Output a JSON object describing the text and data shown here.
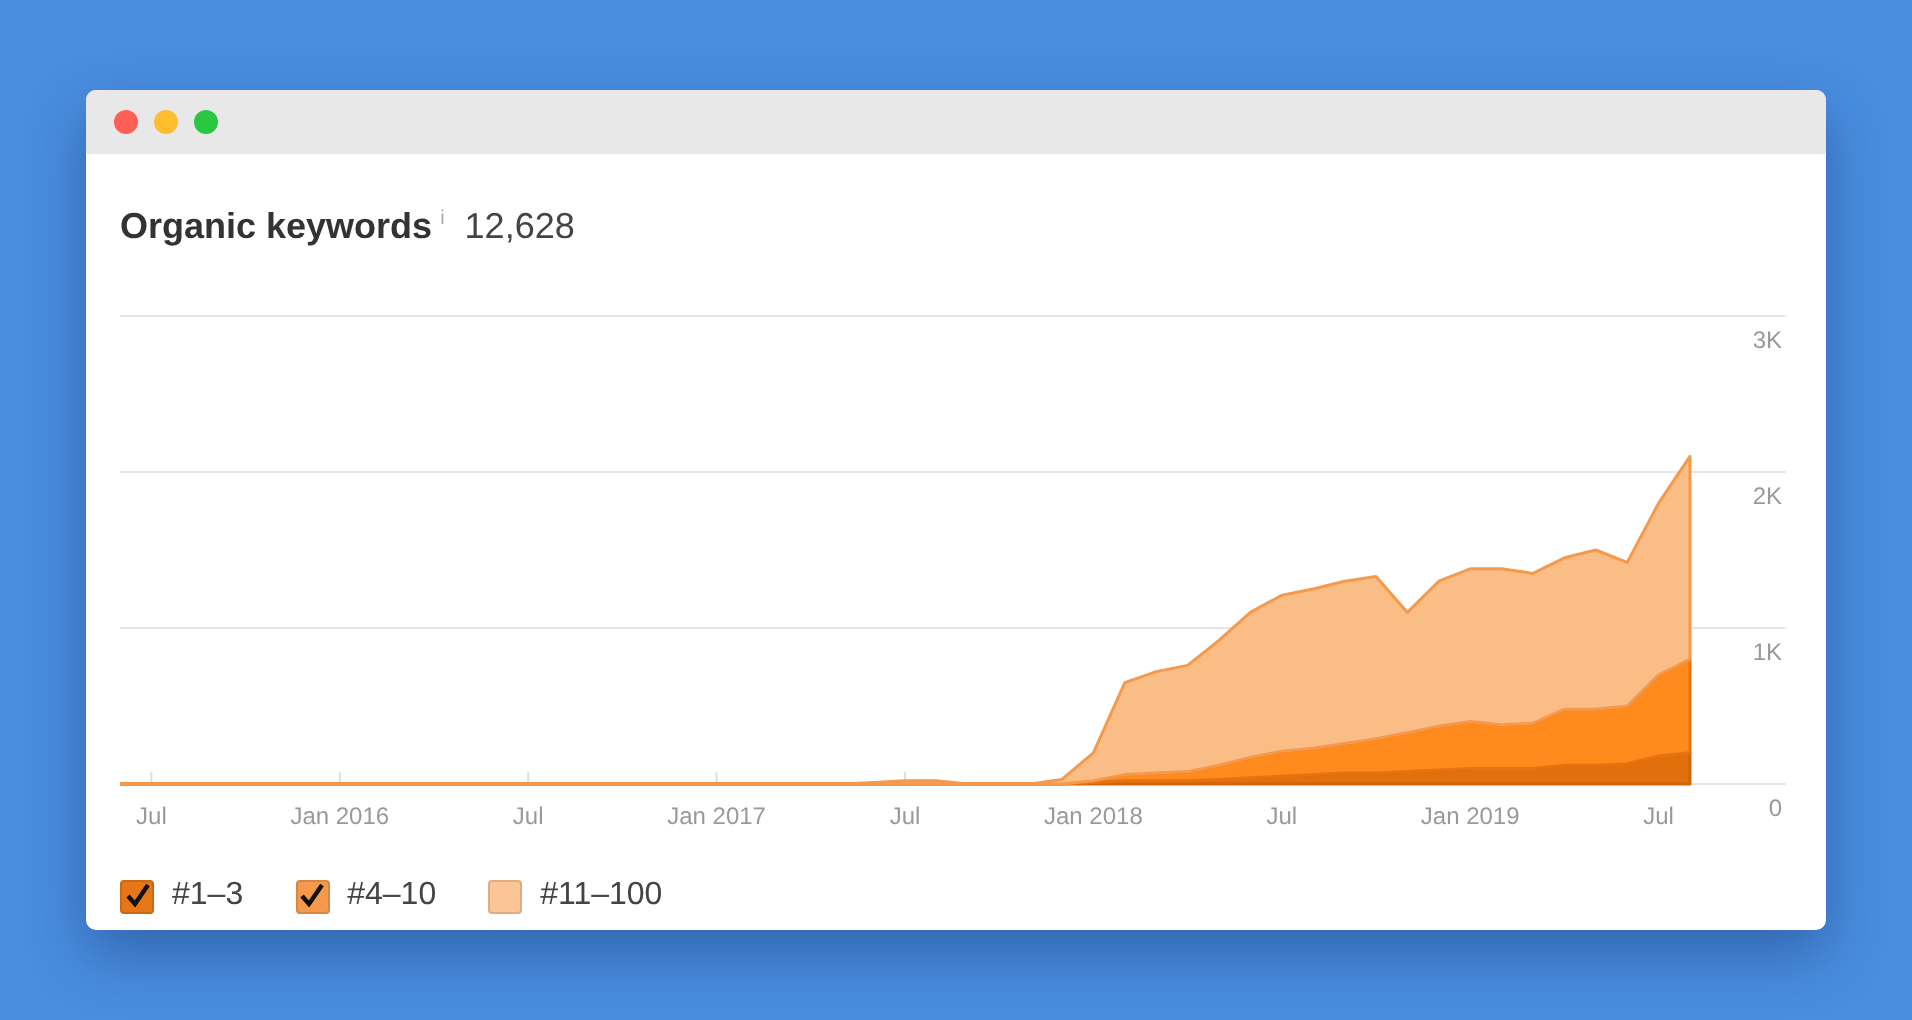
{
  "window": {
    "controls": [
      {
        "color": "#fe5f57"
      },
      {
        "color": "#febc2e"
      },
      {
        "color": "#28c840"
      }
    ]
  },
  "header": {
    "title": "Organic keywords",
    "info": "i",
    "value": "12,628"
  },
  "chart_data": {
    "type": "area",
    "stacked": true,
    "categories": [
      null,
      "Jul",
      null,
      null,
      null,
      null,
      null,
      "Jan 2016",
      null,
      null,
      null,
      null,
      null,
      "Jul",
      null,
      null,
      null,
      null,
      null,
      "Jan 2017",
      null,
      null,
      null,
      null,
      null,
      "Jul",
      null,
      null,
      null,
      null,
      null,
      "Jan 2018",
      null,
      null,
      null,
      null,
      null,
      "Jul",
      null,
      null,
      null,
      null,
      null,
      "Jan 2019",
      null,
      null,
      null,
      null,
      null,
      "Jul",
      null
    ],
    "series": [
      {
        "name": "#1–3",
        "color": "#e06f0c",
        "values": [
          0,
          0,
          0,
          0,
          0,
          0,
          0,
          0,
          0,
          0,
          0,
          0,
          0,
          0,
          0,
          0,
          0,
          0,
          0,
          0,
          0,
          0,
          0,
          0,
          0,
          0,
          0,
          0,
          0,
          0,
          0,
          10,
          20,
          20,
          20,
          30,
          40,
          50,
          60,
          70,
          70,
          80,
          90,
          100,
          100,
          100,
          120,
          120,
          130,
          180,
          200
        ]
      },
      {
        "name": "#4–10",
        "color": "#ff8a1e",
        "values": [
          0,
          0,
          0,
          0,
          0,
          0,
          0,
          0,
          0,
          0,
          0,
          0,
          0,
          0,
          0,
          0,
          0,
          0,
          0,
          0,
          0,
          0,
          0,
          0,
          0,
          0,
          0,
          0,
          0,
          0,
          0,
          10,
          40,
          50,
          60,
          90,
          130,
          160,
          170,
          190,
          220,
          250,
          280,
          300,
          280,
          290,
          360,
          360,
          370,
          520,
          600
        ]
      },
      {
        "name": "#11–100",
        "color": "#fbbd86",
        "values": [
          0,
          0,
          0,
          0,
          0,
          0,
          0,
          0,
          0,
          0,
          0,
          0,
          0,
          0,
          0,
          0,
          0,
          0,
          0,
          0,
          0,
          0,
          0,
          0,
          10,
          20,
          20,
          0,
          0,
          0,
          30,
          180,
          590,
          650,
          680,
          800,
          930,
          1000,
          1020,
          1040,
          1040,
          770,
          930,
          980,
          1000,
          960,
          970,
          1020,
          920,
          1100,
          1300
        ]
      }
    ],
    "ylim": [
      0,
      3000
    ],
    "yticks": [
      {
        "value": 0,
        "label": "0"
      },
      {
        "value": 1000,
        "label": "1K"
      },
      {
        "value": 2000,
        "label": "2K"
      },
      {
        "value": 3000,
        "label": "3K"
      }
    ]
  },
  "legend": [
    {
      "checked": true,
      "color": "#e57719"
    },
    {
      "checked": true,
      "color": "#f59a4c"
    },
    {
      "checked": false,
      "color": "#fbc596"
    }
  ]
}
